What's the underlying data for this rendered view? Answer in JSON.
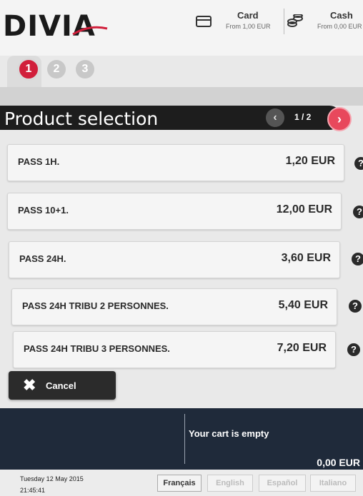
{
  "header": {
    "logo": "DIVIA",
    "card": {
      "title": "Card",
      "subtitle": "From 1,00 EUR"
    },
    "cash": {
      "title": "Cash",
      "subtitle": "From 0,00 EUR"
    }
  },
  "steps": [
    "1",
    "2",
    "3"
  ],
  "page": {
    "title": "Product selection",
    "pager": "1 / 2",
    "prev_icon": "‹",
    "next_icon": "›"
  },
  "products": [
    {
      "name": "PASS 1H.",
      "price": "1,20 EUR"
    },
    {
      "name": "PASS 10+1.",
      "price": "12,00 EUR"
    },
    {
      "name": "PASS 24H.",
      "price": "3,60 EUR"
    },
    {
      "name": "PASS 24H TRIBU 2 PERSONNES.",
      "price": "5,40 EUR"
    },
    {
      "name": "PASS 24H TRIBU 3 PERSONNES.",
      "price": "7,20 EUR"
    }
  ],
  "help_icon": "?",
  "cancel": {
    "label": "Cancel",
    "icon": "✖"
  },
  "cart": {
    "message": "Your cart is empty",
    "total": "0,00 EUR"
  },
  "footer": {
    "date": "Tuesday 12 May 2015",
    "time": "21:45:41",
    "languages": [
      "Français",
      "English",
      "Español",
      "Italiano"
    ]
  },
  "colors": {
    "accent": "#d11f3b",
    "title_bar": "#1d1d1d",
    "cart_bg": "#1f2a3a"
  }
}
